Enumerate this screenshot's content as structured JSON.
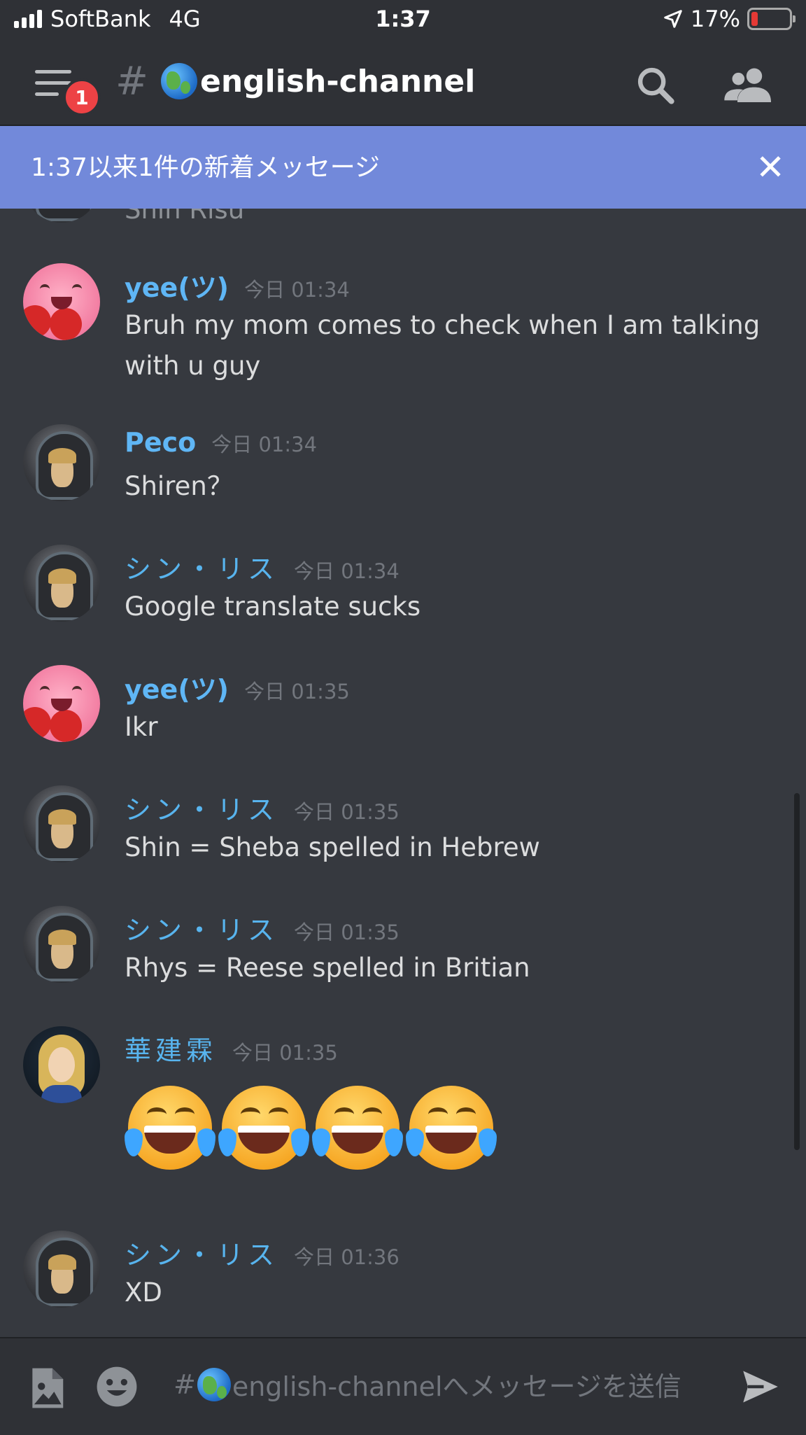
{
  "status_bar": {
    "carrier": "SoftBank",
    "network": "4G",
    "time": "1:37",
    "battery": "17%"
  },
  "header": {
    "badge_count": "1",
    "hash": "#",
    "channel_name": "english-channel",
    "icons": [
      "menu-icon",
      "search-icon",
      "members-icon"
    ]
  },
  "banner": {
    "text": "1:37以来1件の新着メッセージ",
    "close": "✕"
  },
  "partial_top_name": "Shin Risu",
  "messages": [
    {
      "author": "yee(ツ)",
      "timestamp": "今日 01:34",
      "text": "Bruh my mom comes to check when I am talking with u guy"
    },
    {
      "author": "Peco",
      "timestamp": "今日 01:34",
      "text": "Shiren？"
    },
    {
      "author": "シン・リス",
      "timestamp": "今日 01:34",
      "text": "Google translate sucks"
    },
    {
      "author": "yee(ツ)",
      "timestamp": "今日 01:35",
      "text": "Ikr"
    },
    {
      "author": "シン・リス",
      "timestamp": "今日 01:35",
      "text": "Shin = Sheba spelled in Hebrew"
    },
    {
      "author": "シン・リス",
      "timestamp": "今日 01:35",
      "text": "Rhys = Reese spelled in Britian"
    },
    {
      "author": "華建霖",
      "timestamp": "今日 01:35",
      "text": "😂😂😂😂"
    },
    {
      "author": "シン・リス",
      "timestamp": "今日 01:36",
      "text": "XD"
    }
  ],
  "composer": {
    "prefix": "#",
    "placeholder_suffix": "english-channelへメッセージを送信",
    "icons": [
      "image-icon",
      "emoji-icon",
      "send-icon"
    ]
  },
  "colors": {
    "background": "#36393f",
    "header": "#2f3136",
    "banner": "#7289da",
    "username": "#5fb6f5",
    "badge": "#ed4245"
  }
}
